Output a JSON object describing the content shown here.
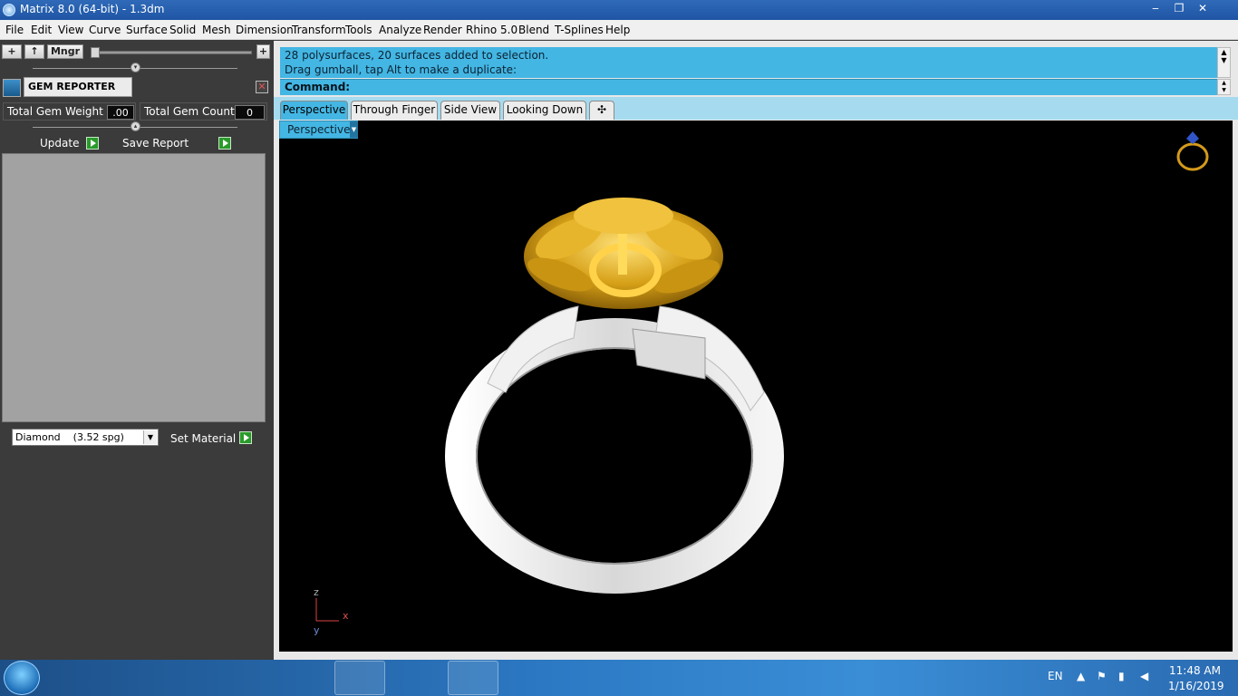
{
  "window": {
    "title": "Matrix 8.0 (64-bit) - 1.3dm",
    "minimize": "‒",
    "maximize": "❐",
    "close": "✕"
  },
  "menu": [
    "File",
    "Edit",
    "View",
    "Curve",
    "Surface",
    "Solid",
    "Mesh",
    "Dimension",
    "Transform",
    "Tools",
    "Analyze",
    "Render",
    "Rhino 5.0",
    "Blend",
    "T-Splines",
    "Help"
  ],
  "left_toolbar": {
    "add": "+",
    "up": "↑",
    "manager": "Mngr",
    "plus_right": "+"
  },
  "gem_reporter": {
    "title": "GEM REPORTER",
    "close": "✕",
    "weight_label": "Total Gem Weight",
    "weight_value": ".00",
    "count_label": "Total Gem Count",
    "count_value": "0",
    "update_label": "Update",
    "save_label": "Save Report",
    "material_value": "Diamond    (3.52 spg)",
    "set_material_label": "Set Material"
  },
  "command": {
    "history": [
      "28 polysurfaces, 20 surfaces added to selection.",
      "Drag gumball, tap Alt to make a duplicate:"
    ],
    "prompt": "Command:"
  },
  "tabs": [
    "Perspective",
    "Through Finger",
    "Side View",
    "Looking Down"
  ],
  "tab_add": "✣",
  "active_tab": "Perspective",
  "viewport": {
    "label": "Perspective",
    "axis_z": "z",
    "axis_x": "x",
    "axis_y": "y"
  },
  "taskbar": {
    "language": "EN",
    "time": "11:48 AM",
    "date": "1/16/2019"
  },
  "colors": {
    "accent": "#44b6e3",
    "panel": "#3b3b3b",
    "gold": "#d4a21a",
    "ring_white": "#e6e6e6"
  }
}
